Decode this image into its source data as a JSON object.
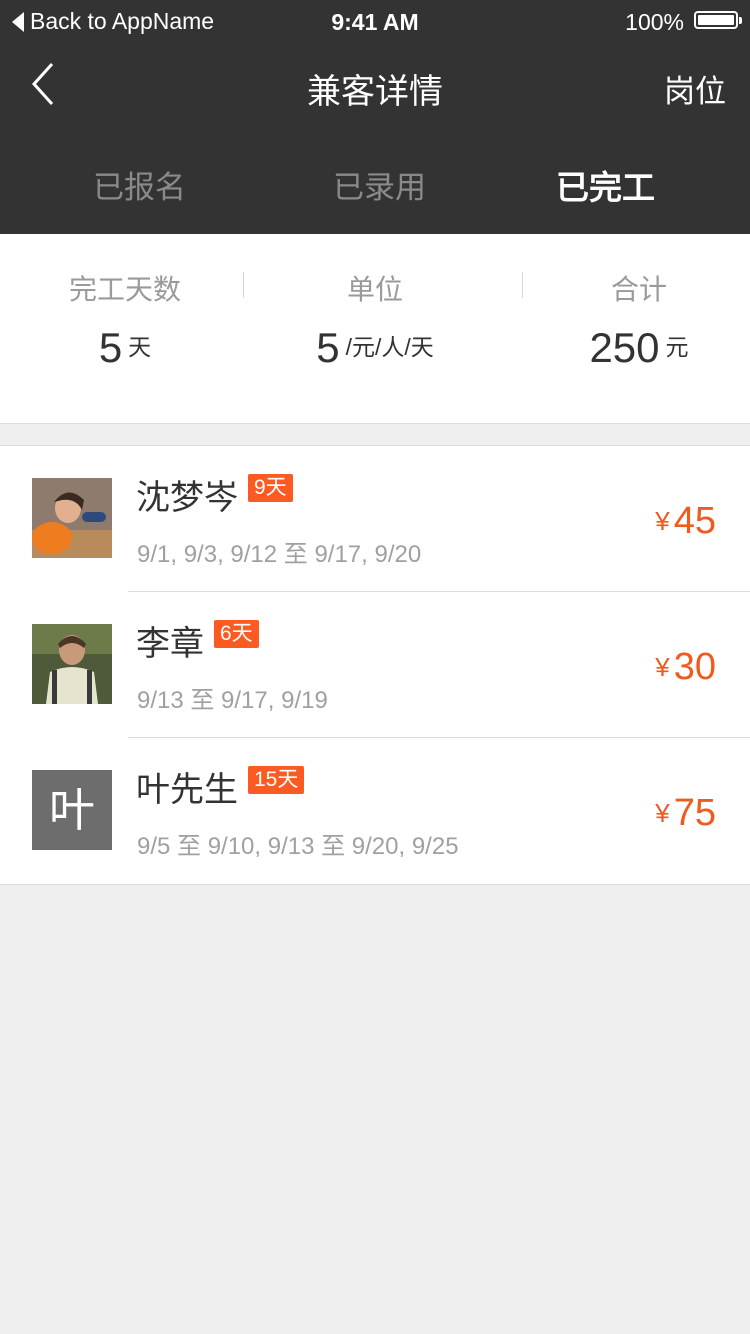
{
  "status_bar": {
    "back_label": "Back to AppName",
    "time": "9:41 AM",
    "battery": "100%"
  },
  "nav": {
    "title": "兼客详情",
    "right_label": "岗位",
    "back_icon": "chevron-left-icon"
  },
  "tabs": [
    {
      "label": "已报名",
      "active": false
    },
    {
      "label": "已录用",
      "active": false
    },
    {
      "label": "已完工",
      "active": true
    }
  ],
  "summary": {
    "days": {
      "label": "完工天数",
      "value": "5",
      "unit": "天"
    },
    "unit_price": {
      "label": "单位",
      "value": "5",
      "unit": "/元/人/天"
    },
    "total": {
      "label": "合计",
      "value": "250",
      "unit": "元"
    }
  },
  "workers": [
    {
      "name": "沈梦岑",
      "badge": "9天",
      "dates": "9/1, 9/3, 9/12 至 9/17, 9/20",
      "currency": "¥",
      "amount": "45",
      "avatar": "photo"
    },
    {
      "name": "李章",
      "badge": "6天",
      "dates": "9/13 至 9/17, 9/19",
      "currency": "¥",
      "amount": "30",
      "avatar": "photo"
    },
    {
      "name": "叶先生",
      "badge": "15天",
      "dates": "9/5 至 9/10, 9/13 至 9/20, 9/25",
      "currency": "¥",
      "amount": "75",
      "avatar": "叶"
    }
  ],
  "colors": {
    "header_bg": "#333333",
    "accent": "#f05a1e",
    "badge_bg": "#fb5a22",
    "page_bg": "#efefef"
  }
}
